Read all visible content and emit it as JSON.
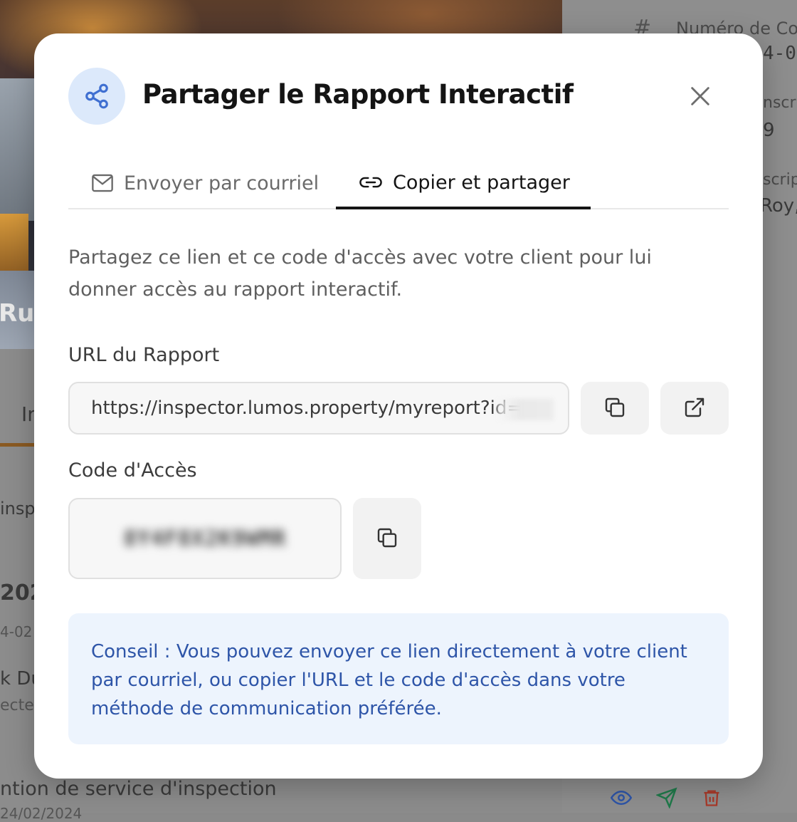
{
  "background": {
    "photo_caption": "Rue",
    "right_panel": {
      "field1_label": "Numéro de Con",
      "field1_value": "4-0",
      "field2_label": "nscr",
      "field2_value": "9",
      "field3_label": "scrip",
      "field3_value": "Roy,"
    },
    "left_panel": {
      "tab_label": "In",
      "row1_label": "insp",
      "year": "202",
      "date_fragment": "4-02",
      "name_fragment": "k Du",
      "role_fragment": "ecteu",
      "footer_title": "ntion de service d'inspection",
      "footer_date": "24/02/2024"
    }
  },
  "modal": {
    "title": "Partager le Rapport Interactif",
    "tabs": [
      {
        "label": "Envoyer par courriel",
        "icon": "mail-icon",
        "active": false
      },
      {
        "label": "Copier et partager",
        "icon": "link-icon",
        "active": true
      }
    ],
    "description": "Partagez ce lien et ce code d'accès avec votre client pour lui donner accès au rapport interactif.",
    "url_label": "URL du Rapport",
    "url_value": "https://inspector.lumos.property/myreport?id=",
    "code_label": "Code d'Accès",
    "code_value": "8Y4F8X2K9WMR",
    "tip": "Conseil : Vous pouvez envoyer ce lien directement à votre client par courriel, ou copier l'URL et le code d'accès dans votre méthode de communication préférée."
  },
  "colors": {
    "accent_blue": "#2e55a8",
    "badge_bg": "#dce9fb",
    "tip_bg": "#edf4fd",
    "icon_blue": "#3f6fd1"
  }
}
